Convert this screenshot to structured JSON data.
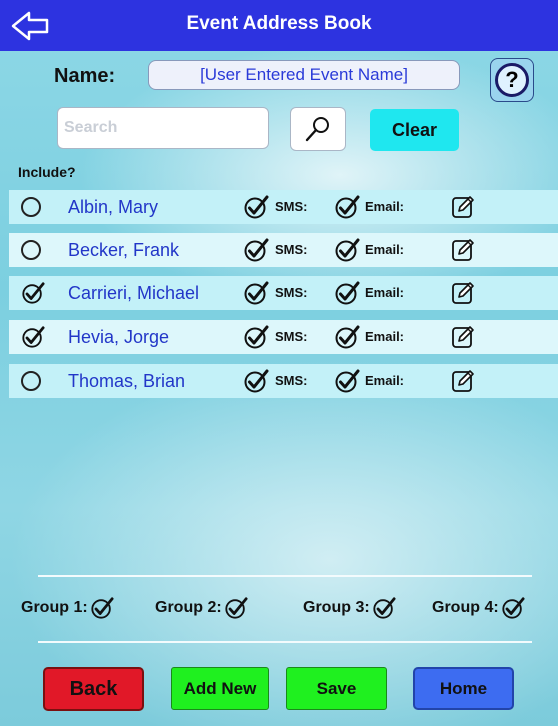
{
  "header": {
    "title": "Event Address Book",
    "back_icon": "back-arrow-icon"
  },
  "event": {
    "name_label": "Name:",
    "name_value": "[User Entered Event Name]",
    "help_label": "?"
  },
  "search": {
    "placeholder": "Search",
    "clear_label": "Clear"
  },
  "list": {
    "include_label": "Include?",
    "sms_label": "SMS:",
    "email_label": "Email:",
    "contacts": [
      {
        "name": "Albin, Mary",
        "included": false
      },
      {
        "name": "Becker,  Frank",
        "included": false
      },
      {
        "name": "Carrieri, Michael",
        "included": true
      },
      {
        "name": "Hevia, Jorge",
        "included": true
      },
      {
        "name": "Thomas, Brian",
        "included": false
      }
    ]
  },
  "groups": [
    {
      "label": "Group 1:"
    },
    {
      "label": "Group 2:"
    },
    {
      "label": "Group 3:"
    },
    {
      "label": "Group 4:"
    }
  ],
  "buttons": {
    "back": "Back",
    "add_new": "Add New",
    "save": "Save",
    "home": "Home"
  },
  "colors": {
    "topbar": "#2d33e0",
    "contact_name": "#2236c8",
    "clear": "#1fe7ef",
    "back": "#e11828",
    "green": "#1ff01f",
    "home": "#3d6cf1"
  }
}
